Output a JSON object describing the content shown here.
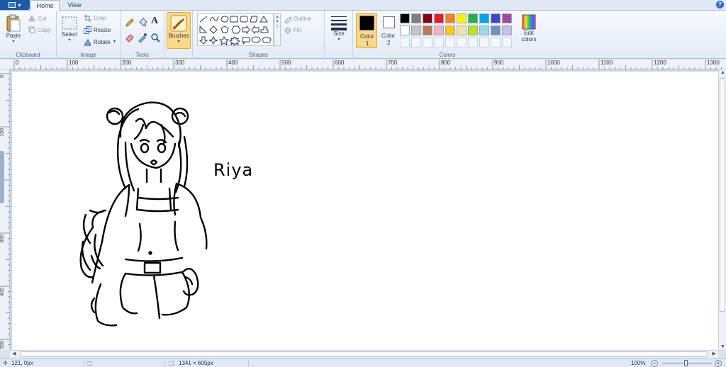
{
  "tabs": {
    "home": "Home",
    "view": "View"
  },
  "help_label": "?",
  "clipboard": {
    "paste": "Paste",
    "cut": "Cut",
    "copy": "Copy",
    "group": "Clipboard"
  },
  "image": {
    "select": "Select",
    "crop": "Crop",
    "resize": "Resize",
    "rotate": "Rotate",
    "group": "Image"
  },
  "tools": {
    "group": "Tools",
    "text_tool": "A"
  },
  "brushes": {
    "label": "Brushes"
  },
  "shapes": {
    "outline": "Outline",
    "fill": "Fill",
    "group": "Shapes"
  },
  "size": {
    "label": "Size"
  },
  "colors": {
    "color1_label": "Color",
    "color1_num": "1",
    "color2_label": "Color",
    "color2_num": "2",
    "edit_label": "Edit",
    "edit_label2": "colors",
    "group": "Colors",
    "row1": [
      "#000000",
      "#7f7f7f",
      "#880015",
      "#ed1c24",
      "#ff7f27",
      "#fff200",
      "#22b14c",
      "#00a2e8",
      "#3f48cc",
      "#a349a4"
    ],
    "row2": [
      "#ffffff",
      "#c3c3c3",
      "#b97a57",
      "#ffaec9",
      "#ffc90e",
      "#efe4b0",
      "#b5e61d",
      "#99d9ea",
      "#7092be",
      "#c8bfe7"
    ],
    "color1_value": "#000000",
    "color2_value": "#ffffff"
  },
  "ruler": {
    "h": [
      "0",
      "100",
      "200",
      "300",
      "400",
      "500",
      "600",
      "700",
      "800",
      "900",
      "1000",
      "1100",
      "1200",
      "1300"
    ],
    "v": [
      "0",
      "100",
      "200",
      "300",
      "400",
      "500"
    ]
  },
  "canvas": {
    "signature": "Riya"
  },
  "status": {
    "cursor": "121, 0px",
    "size": "1341 × 605px",
    "zoom": "100%"
  }
}
